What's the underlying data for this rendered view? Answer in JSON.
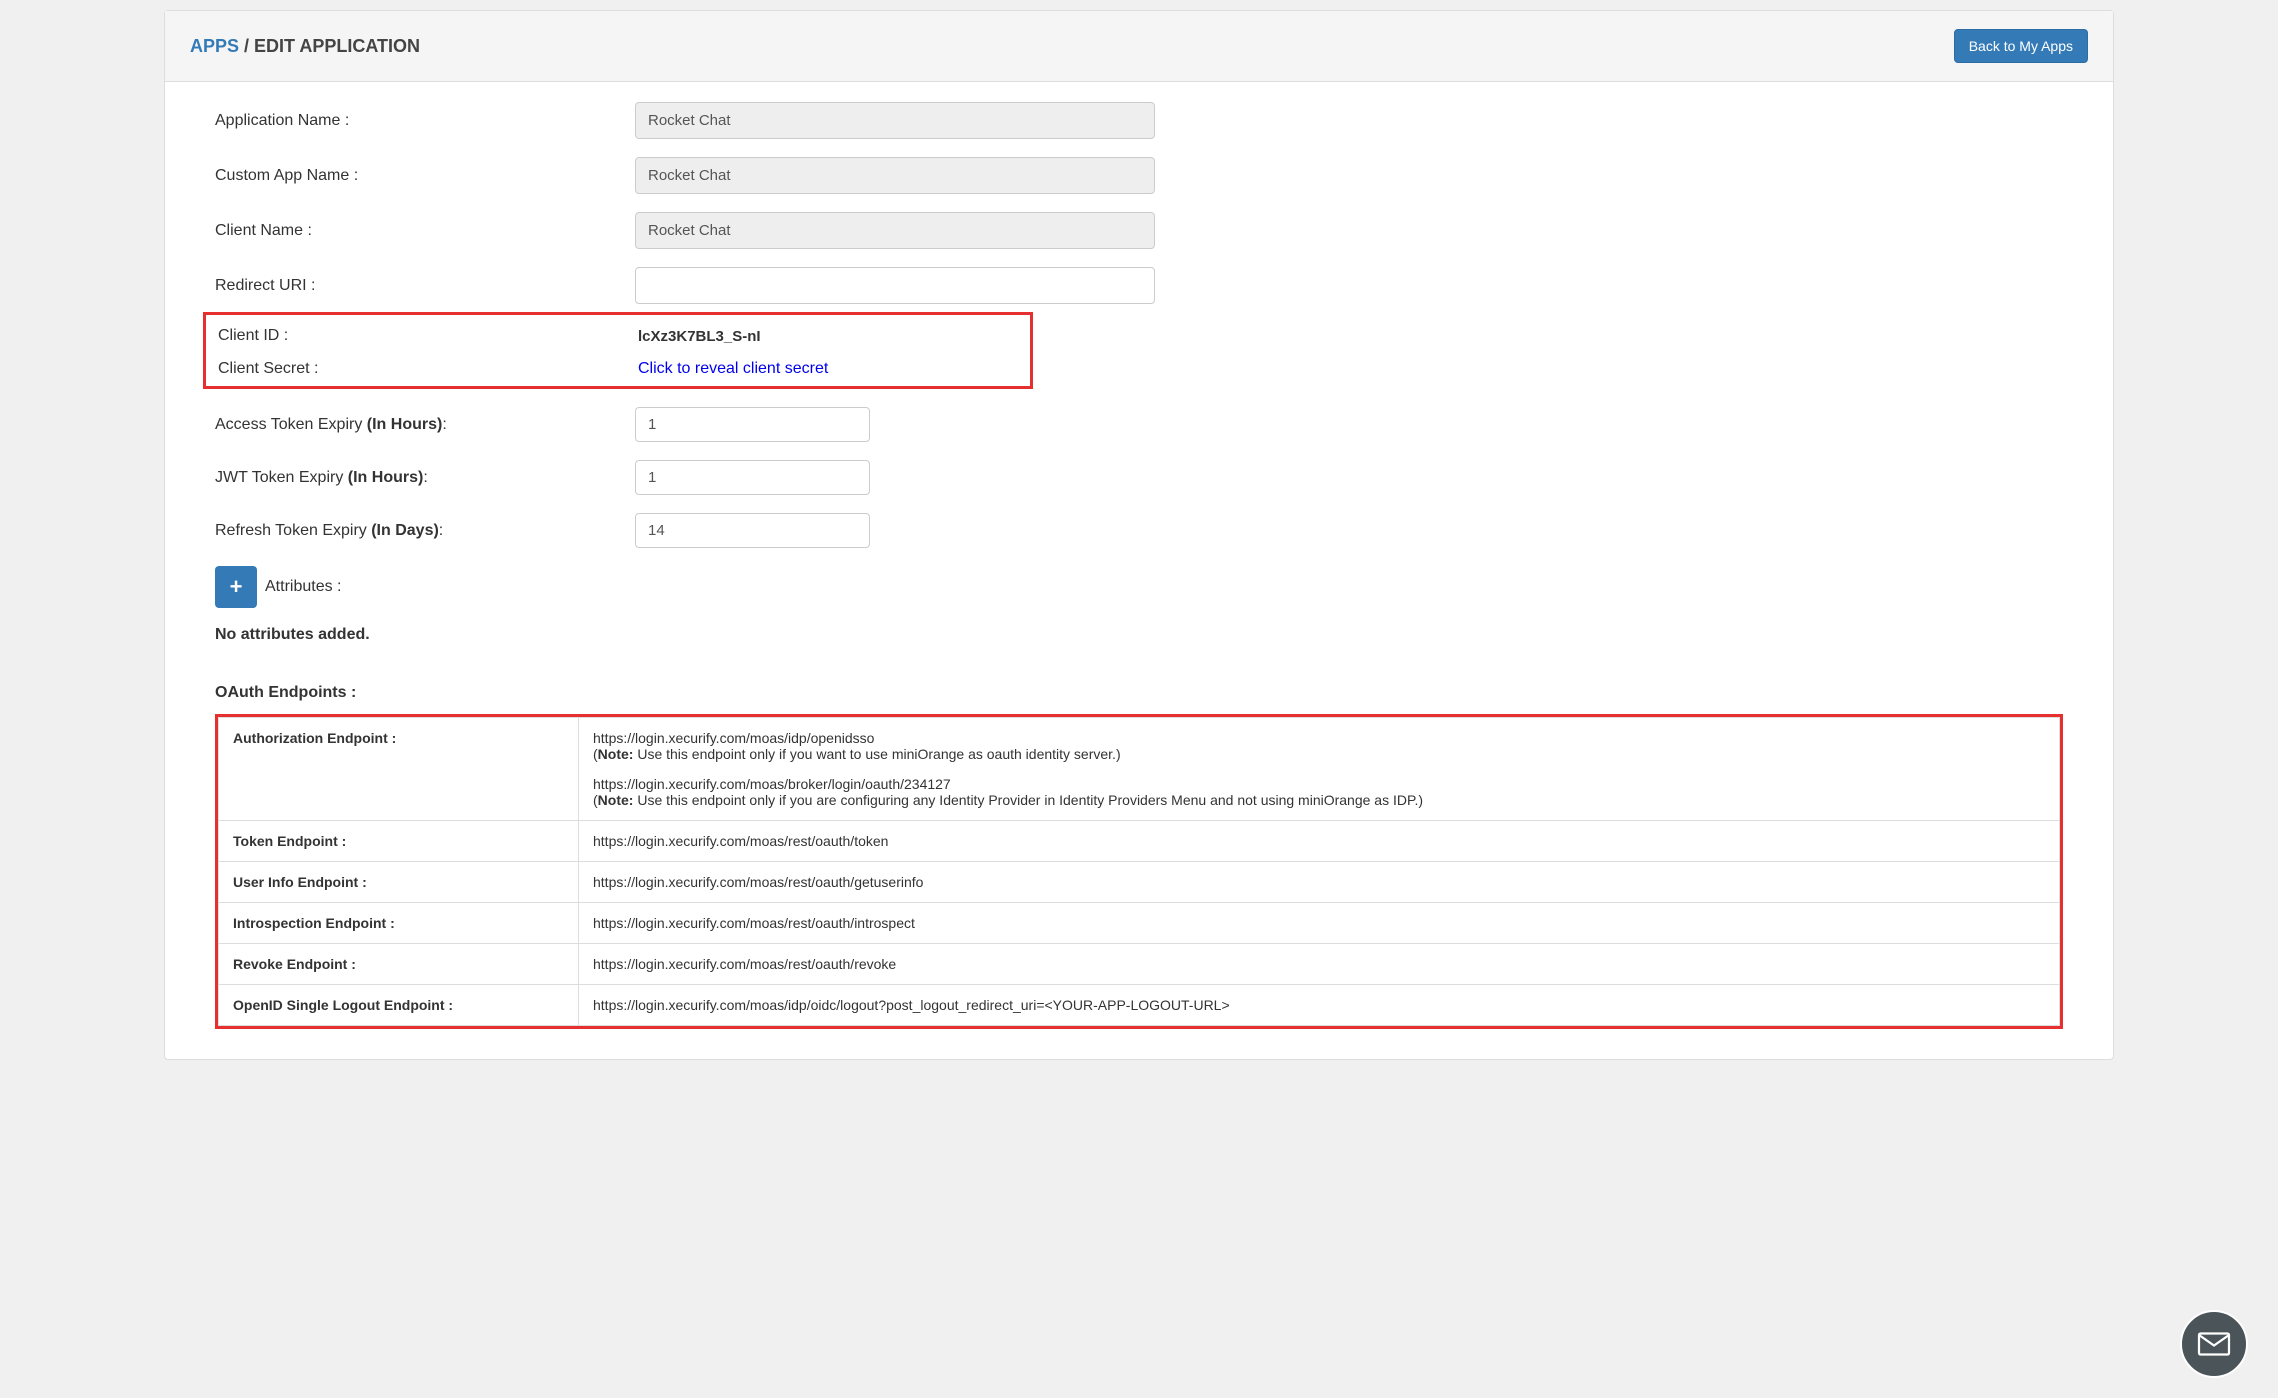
{
  "breadcrumb": {
    "apps": "APPS",
    "sep": " / ",
    "page": "EDIT APPLICATION"
  },
  "header": {
    "back_button": "Back to My Apps"
  },
  "form": {
    "app_name": {
      "label": "Application Name :",
      "value": "Rocket Chat"
    },
    "custom_name": {
      "label": "Custom App Name :",
      "value": "Rocket Chat"
    },
    "client_name": {
      "label": "Client Name :",
      "value": "Rocket Chat"
    },
    "redirect_uri": {
      "label": "Redirect URI :",
      "value": ""
    },
    "client_id": {
      "label": "Client ID :",
      "value": "lcXz3K7BL3_S-nI"
    },
    "client_secret": {
      "label": "Client Secret :",
      "reveal": "Click to reveal client secret"
    },
    "access_token": {
      "label": "Access Token Expiry ",
      "bold": "(In Hours)",
      "colon": ":",
      "value": "1"
    },
    "jwt_token": {
      "label": "JWT Token Expiry ",
      "bold": "(In Hours)",
      "colon": ":",
      "value": "1"
    },
    "refresh_token": {
      "label": "Refresh Token Expiry ",
      "bold": "(In Days)",
      "colon": ":",
      "value": "14"
    }
  },
  "attributes": {
    "label": "Attributes :",
    "empty": "No attributes added."
  },
  "endpoints": {
    "title": "OAuth Endpoints :",
    "rows": [
      {
        "label": "Authorization Endpoint :",
        "url1": "https://login.xecurify.com/moas/idp/openidsso",
        "note1_pre": "(",
        "note1_bold": "Note:",
        "note1_text": " Use this endpoint only if you want to use miniOrange as oauth identity server.)",
        "url2": "https://login.xecurify.com/moas/broker/login/oauth/234127",
        "note2_pre": "(",
        "note2_bold": "Note:",
        "note2_text": " Use this endpoint only if you are configuring any Identity Provider in Identity Providers Menu and not using miniOrange as IDP.)"
      },
      {
        "label": "Token Endpoint :",
        "url": "https://login.xecurify.com/moas/rest/oauth/token"
      },
      {
        "label": "User Info Endpoint :",
        "url": "https://login.xecurify.com/moas/rest/oauth/getuserinfo"
      },
      {
        "label": "Introspection Endpoint :",
        "url": "https://login.xecurify.com/moas/rest/oauth/introspect"
      },
      {
        "label": "Revoke Endpoint :",
        "url": "https://login.xecurify.com/moas/rest/oauth/revoke"
      },
      {
        "label": "OpenID Single Logout Endpoint :",
        "url": "https://login.xecurify.com/moas/idp/oidc/logout?post_logout_redirect_uri=<YOUR-APP-LOGOUT-URL>"
      }
    ]
  }
}
